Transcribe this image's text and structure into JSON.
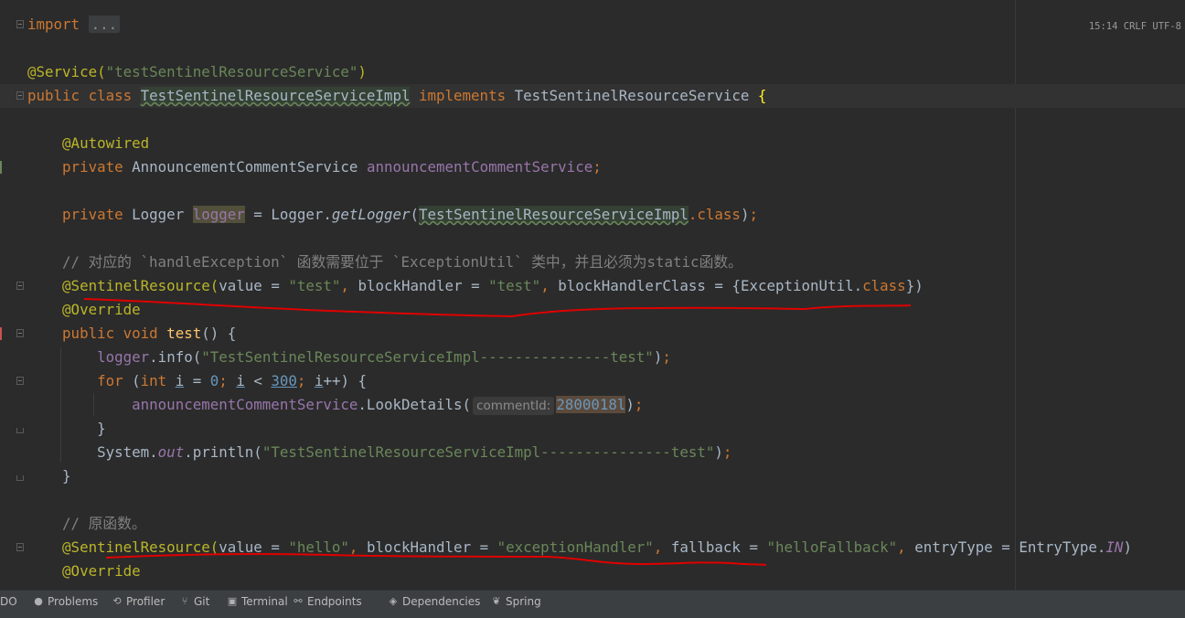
{
  "editor": {
    "lines": [
      {
        "id": "import",
        "parts": [
          [
            "k",
            "import "
          ],
          [
            "foldbox",
            "..."
          ]
        ]
      },
      {
        "id": "blank1",
        "parts": []
      },
      {
        "id": "service-annotation",
        "parts": [
          [
            "a",
            "@Service("
          ],
          [
            "s",
            "\"testSentinelResourceService\""
          ],
          [
            "a",
            ")"
          ]
        ]
      },
      {
        "id": "class-decl",
        "parts": [
          [
            "k",
            "public class "
          ],
          [
            "hl-def",
            "TestSentinelResourceServiceImpl"
          ],
          [
            "t",
            " "
          ],
          [
            "k",
            "implements "
          ],
          [
            "t",
            "TestSentinelResourceService "
          ],
          [
            "brace",
            "{"
          ]
        ]
      },
      {
        "id": "blank2",
        "parts": []
      },
      {
        "id": "autowired",
        "parts": [
          [
            "t",
            "    "
          ],
          [
            "a",
            "@Autowired"
          ]
        ]
      },
      {
        "id": "field-service",
        "parts": [
          [
            "t",
            "    "
          ],
          [
            "k",
            "private "
          ],
          [
            "t",
            "AnnouncementCommentService "
          ],
          [
            "f",
            "announcementCommentService"
          ],
          [
            "k",
            ";"
          ]
        ]
      },
      {
        "id": "blank3",
        "parts": []
      },
      {
        "id": "field-logger",
        "parts": [
          [
            "t",
            "    "
          ],
          [
            "k",
            "private "
          ],
          [
            "t",
            "Logger "
          ],
          [
            "hl-use-f",
            "logger"
          ],
          [
            "t",
            " = Logger."
          ],
          [
            "i",
            "getLogger"
          ],
          [
            "t",
            "("
          ],
          [
            "hl-def",
            "TestSentinelResourceServiceImpl"
          ],
          [
            "k",
            ".class"
          ],
          [
            "t",
            ")"
          ],
          [
            "k",
            ";"
          ]
        ]
      },
      {
        "id": "blank4",
        "parts": []
      },
      {
        "id": "comment1",
        "parts": [
          [
            "t",
            "    "
          ],
          [
            "c",
            "// 对应的 `handleException` 函数需要位于 `ExceptionUtil` 类中，并且必须为static函数。"
          ]
        ]
      },
      {
        "id": "sentinel1",
        "parts": [
          [
            "t",
            "    "
          ],
          [
            "a",
            "@SentinelResource("
          ],
          [
            "t",
            "value = "
          ],
          [
            "s",
            "\"test\""
          ],
          [
            "k",
            ", "
          ],
          [
            "t",
            "blockHandler = "
          ],
          [
            "s",
            "\"test\""
          ],
          [
            "k",
            ", "
          ],
          [
            "t",
            "blockHandlerClass = "
          ],
          [
            "t",
            "{ExceptionUtil."
          ],
          [
            "k",
            "class"
          ],
          [
            "t",
            "})"
          ]
        ]
      },
      {
        "id": "override1",
        "parts": [
          [
            "t",
            "    "
          ],
          [
            "a",
            "@Override"
          ]
        ]
      },
      {
        "id": "method-test",
        "parts": [
          [
            "t",
            "    "
          ],
          [
            "k",
            "public void "
          ],
          [
            "m",
            "test"
          ],
          [
            "t",
            "() {"
          ]
        ]
      },
      {
        "id": "logger-info1",
        "parts": [
          [
            "t",
            "        "
          ],
          [
            "f",
            "logger"
          ],
          [
            "t",
            ".info("
          ],
          [
            "s",
            "\"TestSentinelResourceServiceImpl---------------test\""
          ],
          [
            "t",
            ")"
          ],
          [
            "k",
            ";"
          ]
        ]
      },
      {
        "id": "for-loop",
        "parts": [
          [
            "t",
            "        "
          ],
          [
            "k",
            "for "
          ],
          [
            "t",
            "("
          ],
          [
            "k",
            "int "
          ],
          [
            "u",
            "i"
          ],
          [
            "t",
            " = "
          ],
          [
            "n",
            "0"
          ],
          [
            "k",
            "; "
          ],
          [
            "u",
            "i"
          ],
          [
            "t",
            " < "
          ],
          [
            "nu",
            "300"
          ],
          [
            "k",
            "; "
          ],
          [
            "u",
            "i"
          ],
          [
            "t",
            "++) {"
          ]
        ]
      },
      {
        "id": "look-details",
        "parts": [
          [
            "t",
            "            "
          ],
          [
            "f",
            "announcementCommentService"
          ],
          [
            "t",
            ".LookDetails("
          ],
          [
            "hint",
            "commentId:"
          ],
          [
            "hl-num",
            "2800018l"
          ],
          [
            "t",
            ")"
          ],
          [
            "k",
            ";"
          ]
        ]
      },
      {
        "id": "for-close",
        "parts": [
          [
            "t",
            "        }"
          ]
        ]
      },
      {
        "id": "println",
        "parts": [
          [
            "t",
            "        System."
          ],
          [
            "fi",
            "out"
          ],
          [
            "t",
            ".println("
          ],
          [
            "s",
            "\"TestSentinelResourceServiceImpl---------------test\""
          ],
          [
            "t",
            ")"
          ],
          [
            "k",
            ";"
          ]
        ]
      },
      {
        "id": "method-close",
        "parts": [
          [
            "t",
            "    }"
          ]
        ]
      },
      {
        "id": "blank5",
        "parts": []
      },
      {
        "id": "comment2",
        "parts": [
          [
            "t",
            "    "
          ],
          [
            "c",
            "// 原函数。"
          ]
        ]
      },
      {
        "id": "sentinel2",
        "parts": [
          [
            "t",
            "    "
          ],
          [
            "a",
            "@SentinelResource("
          ],
          [
            "t",
            "value = "
          ],
          [
            "s",
            "\"hello\""
          ],
          [
            "k",
            ", "
          ],
          [
            "t",
            "blockHandler = "
          ],
          [
            "s",
            "\"exceptionHandler\""
          ],
          [
            "k",
            ", "
          ],
          [
            "t",
            "fallback = "
          ],
          [
            "s",
            "\"helloFallback\""
          ],
          [
            "k",
            ", "
          ],
          [
            "t",
            "entryType = EntryType."
          ],
          [
            "fi",
            "IN"
          ],
          [
            "t",
            ")"
          ]
        ]
      },
      {
        "id": "override2",
        "parts": [
          [
            "t",
            "    "
          ],
          [
            "a",
            "@Override"
          ]
        ]
      }
    ]
  },
  "toolwindows": [
    {
      "label": "DO",
      "icon": "todo-icon",
      "glyph": ""
    },
    {
      "label": "Problems",
      "icon": "problems-icon",
      "glyph": "●"
    },
    {
      "label": "Profiler",
      "icon": "profiler-icon",
      "glyph": "⟲"
    },
    {
      "label": "Git",
      "icon": "git-icon",
      "glyph": "⑂"
    },
    {
      "label": "Terminal",
      "icon": "terminal-icon",
      "glyph": "▣"
    },
    {
      "label": "Endpoints",
      "icon": "endpoints-icon",
      "glyph": "⚯"
    },
    {
      "label": "Dependencies",
      "icon": "dependencies-icon",
      "glyph": "◈"
    },
    {
      "label": "Spring",
      "icon": "spring-icon",
      "glyph": "❦"
    }
  ],
  "status": {
    "position": "15:14",
    "line_sep": "CRLF",
    "encoding": "UTF-8"
  },
  "colors": {
    "annotation_underline": "#e00000"
  }
}
